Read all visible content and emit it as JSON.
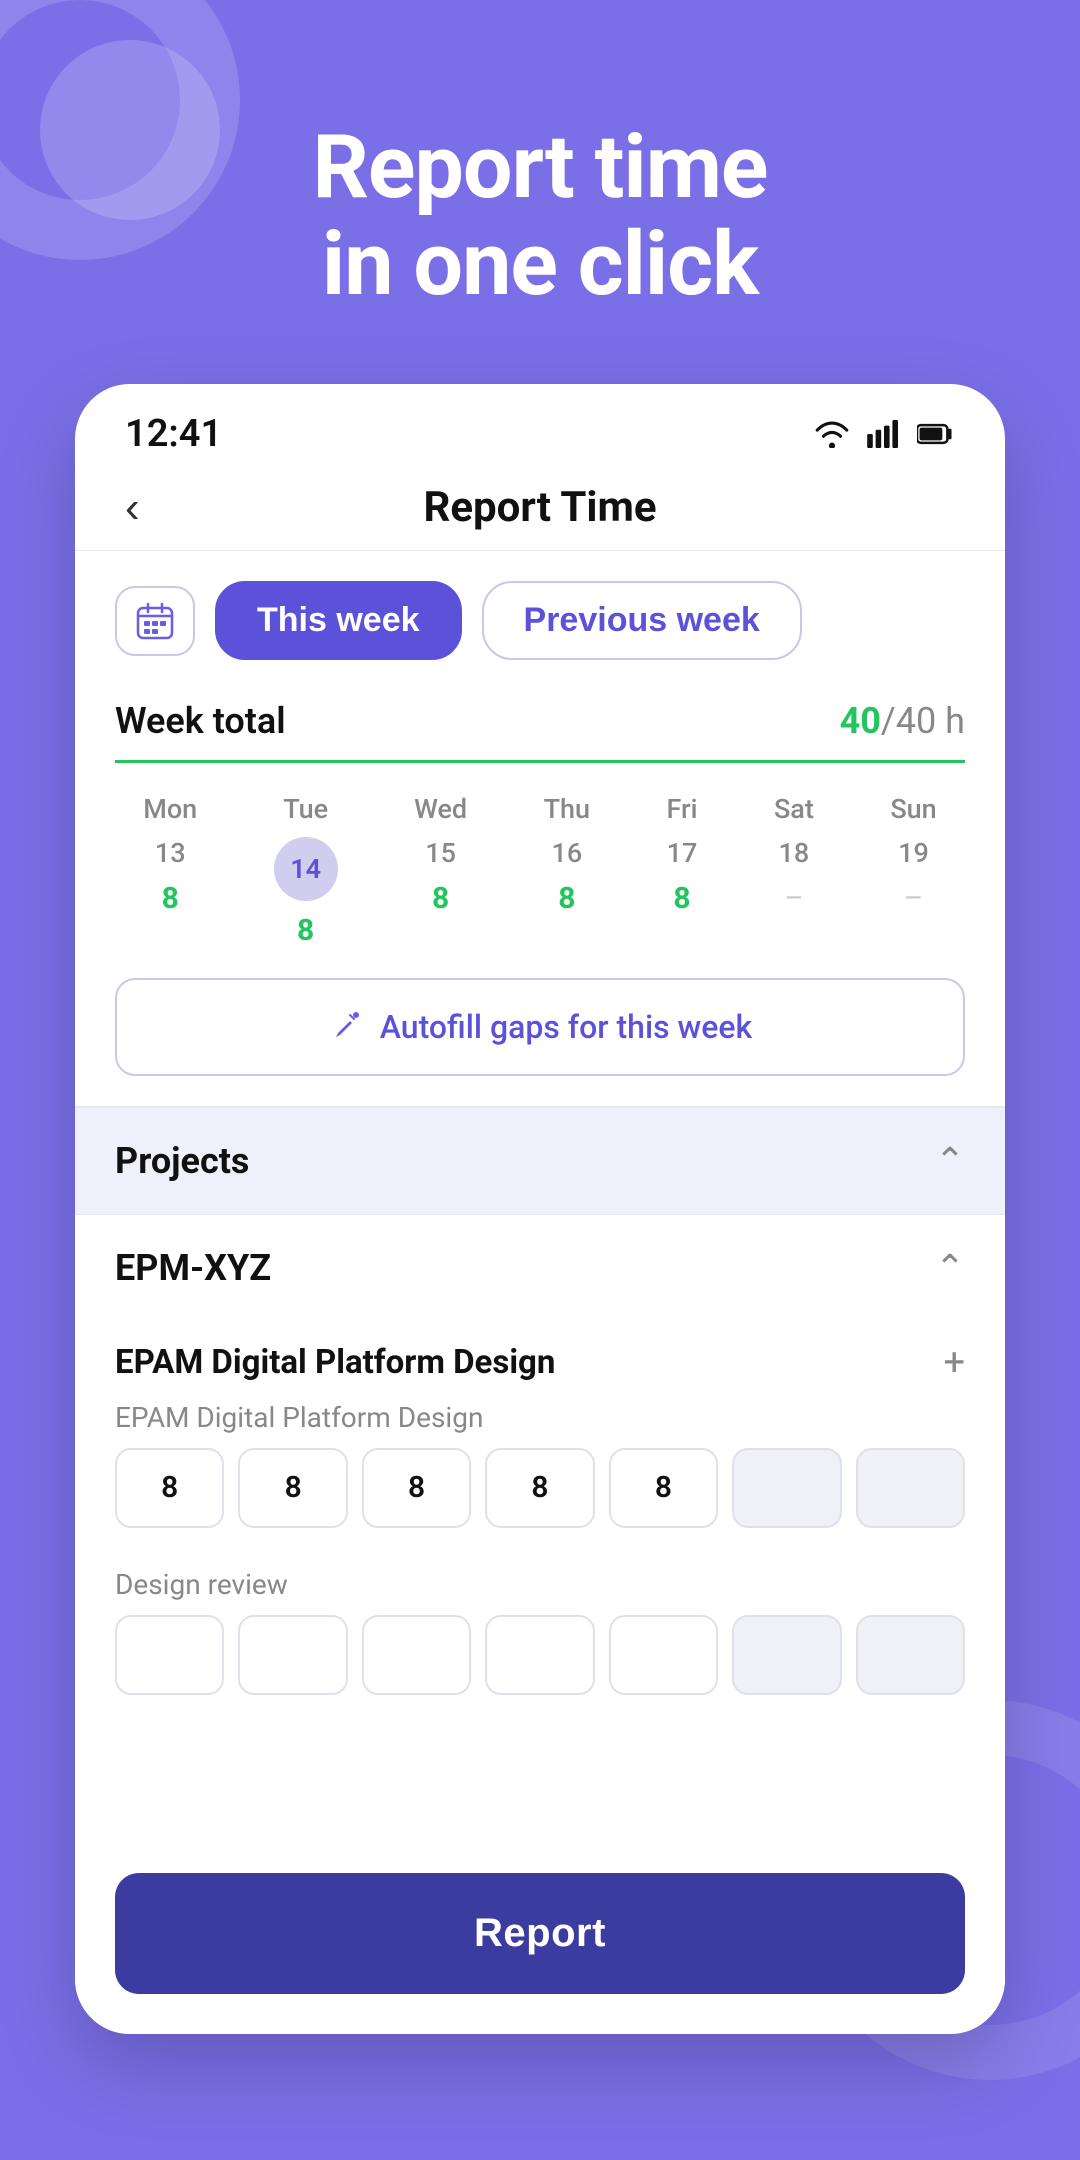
{
  "hero": {
    "title_line1": "Report time",
    "title_line2": "in one click"
  },
  "status_bar": {
    "time": "12:41"
  },
  "nav": {
    "back_label": "‹",
    "title": "Report Time"
  },
  "week_selector": {
    "this_week_label": "This week",
    "previous_week_label": "Previous week"
  },
  "week_total": {
    "label": "Week total",
    "current": "40",
    "separator": "/",
    "max": "40 h"
  },
  "days": [
    {
      "day": "Mon",
      "date": "13",
      "value": "8",
      "today": false
    },
    {
      "day": "Tue",
      "date": "14",
      "value": "8",
      "today": true
    },
    {
      "day": "Wed",
      "date": "15",
      "value": "8",
      "today": false
    },
    {
      "day": "Thu",
      "date": "16",
      "value": "8",
      "today": false
    },
    {
      "day": "Fri",
      "date": "17",
      "value": "8",
      "today": false
    },
    {
      "day": "Sat",
      "date": "18",
      "value": "–",
      "today": false
    },
    {
      "day": "Sun",
      "date": "19",
      "value": "–",
      "today": false
    }
  ],
  "autofill": {
    "label": "Autofill gaps for this week"
  },
  "projects_section": {
    "title": "Projects"
  },
  "epm_section": {
    "title": "EPM-XYZ"
  },
  "task1": {
    "name": "EPAM Digital Platform Design",
    "subtask_name": "EPAM Digital Platform Design",
    "values": [
      "8",
      "8",
      "8",
      "8",
      "8",
      "",
      ""
    ],
    "disabled": [
      false,
      false,
      false,
      false,
      false,
      true,
      true
    ]
  },
  "task2": {
    "name": "Design review",
    "values": [
      "",
      "",
      "",
      "",
      "",
      "",
      ""
    ],
    "disabled": [
      false,
      false,
      false,
      false,
      false,
      true,
      true
    ]
  },
  "report_button": {
    "label": "Report"
  }
}
